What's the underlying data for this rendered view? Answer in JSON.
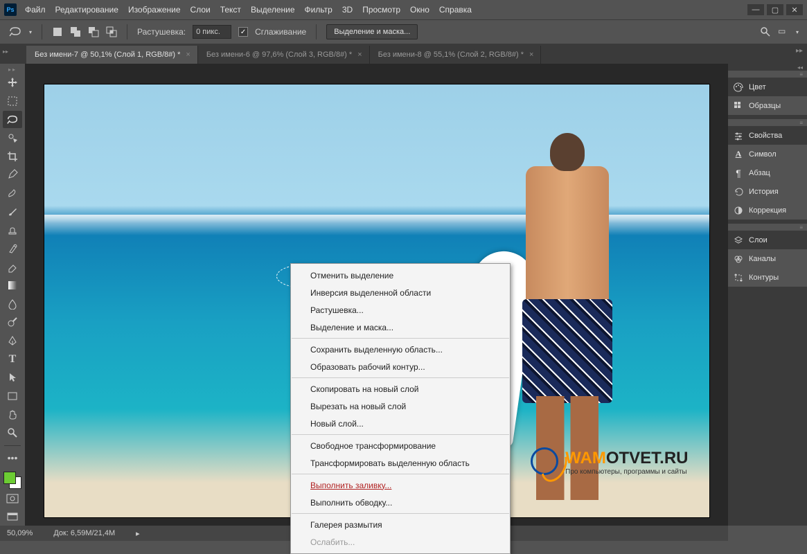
{
  "menu": [
    "Файл",
    "Редактирование",
    "Изображение",
    "Слои",
    "Текст",
    "Выделение",
    "Фильтр",
    "3D",
    "Просмотр",
    "Окно",
    "Справка"
  ],
  "options": {
    "feather_label": "Растушевка:",
    "feather_value": "0 пикс.",
    "antialias": "Сглаживание",
    "select_mask": "Выделение и маска..."
  },
  "tabs": [
    {
      "label": "Без имени-7 @ 50,1% (Слой 1, RGB/8#) *",
      "active": true
    },
    {
      "label": "Без имени-6 @ 97,6% (Слой 3, RGB/8#) *",
      "active": false
    },
    {
      "label": "Без имени-8 @ 55,1% (Слой 2, RGB/8#) *",
      "active": false
    }
  ],
  "right_panels": [
    {
      "group": [
        {
          "icon": "palette",
          "label": "Цвет",
          "active": true
        },
        {
          "icon": "grid",
          "label": "Образцы"
        }
      ]
    },
    {
      "group": [
        {
          "icon": "sliders",
          "label": "Свойства",
          "active": true
        },
        {
          "icon": "A",
          "label": "Символ"
        },
        {
          "icon": "para",
          "label": "Абзац"
        },
        {
          "icon": "history",
          "label": "История"
        },
        {
          "icon": "halfring",
          "label": "Коррекция"
        }
      ]
    },
    {
      "group": [
        {
          "icon": "layers",
          "label": "Слои",
          "active": true
        },
        {
          "icon": "circles",
          "label": "Каналы"
        },
        {
          "icon": "paths",
          "label": "Контуры"
        }
      ]
    }
  ],
  "context_menu": [
    {
      "t": "item",
      "label": "Отменить выделение"
    },
    {
      "t": "item",
      "label": "Инверсия выделенной области"
    },
    {
      "t": "item",
      "label": "Растушевка..."
    },
    {
      "t": "item",
      "label": "Выделение и маска..."
    },
    {
      "t": "sep"
    },
    {
      "t": "item",
      "label": "Сохранить выделенную область..."
    },
    {
      "t": "item",
      "label": "Образовать рабочий контур..."
    },
    {
      "t": "sep"
    },
    {
      "t": "item",
      "label": "Скопировать на новый слой"
    },
    {
      "t": "item",
      "label": "Вырезать на новый слой"
    },
    {
      "t": "item",
      "label": "Новый слой..."
    },
    {
      "t": "sep"
    },
    {
      "t": "item",
      "label": "Свободное трансформирование"
    },
    {
      "t": "item",
      "label": "Трансформировать выделенную область"
    },
    {
      "t": "sep"
    },
    {
      "t": "item",
      "label": "Выполнить заливку...",
      "hl": true
    },
    {
      "t": "item",
      "label": "Выполнить обводку..."
    },
    {
      "t": "sep"
    },
    {
      "t": "item",
      "label": "Галерея размытия"
    },
    {
      "t": "item",
      "label": "Ослабить...",
      "disabled": true
    }
  ],
  "status": {
    "zoom": "50,09%",
    "doc": "Док: 6,59M/21,4M"
  },
  "watermark": {
    "brand1": "WAM",
    "brand2": "OTVET.RU",
    "sub": "Про компьютеры, программы и сайты"
  },
  "colors": {
    "fg": "#6ccc33",
    "bg": "#ffffff"
  }
}
